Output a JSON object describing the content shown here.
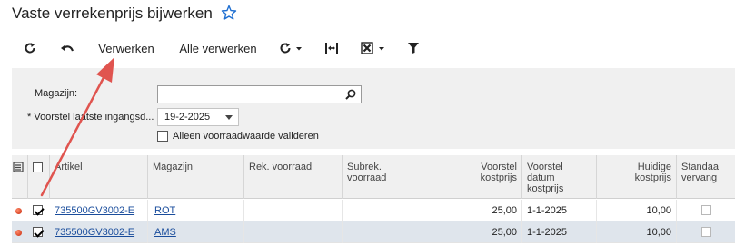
{
  "page": {
    "title": "Vaste verrekenprijs bijwerken"
  },
  "toolbar": {
    "process_label": "Verwerken",
    "process_all_label": "Alle verwerken"
  },
  "filters": {
    "warehouse_label": "Magazijn:",
    "warehouse_value": "",
    "proposal_date_label": "* Voorstel laatste ingangsd...",
    "proposal_date_value": "19-2-2025",
    "validate_only_label": "Alleen voorraadwaarde valideren",
    "validate_only_checked": false
  },
  "grid": {
    "columns": {
      "article": "Artikel",
      "warehouse": "Magazijn",
      "rek_stock": "Rek. voorraad",
      "subrek_stock_1": "Subrek.",
      "subrek_stock_2": "voorraad",
      "proposal_cost_1": "Voorstel",
      "proposal_cost_2": "kostprijs",
      "proposal_date_1": "Voorstel",
      "proposal_date_2": "datum",
      "proposal_date_3": "kostprijs",
      "current_cost_1": "Huidige",
      "current_cost_2": "kostprijs",
      "standard_1": "Standaa",
      "standard_2": "vervang"
    },
    "rows": [
      {
        "checked": true,
        "article": "735500GV3002-E",
        "warehouse": "ROT",
        "rek_stock": "",
        "subrek_stock": "",
        "proposal_cost": "25,00",
        "proposal_date": "1-1-2025",
        "current_cost": "10,00",
        "standard": false
      },
      {
        "checked": true,
        "article": "735500GV3002-E",
        "warehouse": "AMS",
        "rek_stock": "",
        "subrek_stock": "",
        "proposal_cost": "25,00",
        "proposal_date": "1-1-2025",
        "current_cost": "10,00",
        "standard": false
      }
    ]
  },
  "colors": {
    "accent_blue": "#1a4d9c",
    "annotation_arrow": "#e0544f",
    "selected_row": "#dfe5ec"
  },
  "icons": [
    "refresh-icon",
    "undo-icon",
    "refresh-dropdown-icon",
    "fit-columns-icon",
    "excel-export-icon",
    "filter-icon",
    "search-icon",
    "star-icon",
    "calendar-dropdown-icon",
    "row-notes-icon",
    "status-dot-icon"
  ]
}
